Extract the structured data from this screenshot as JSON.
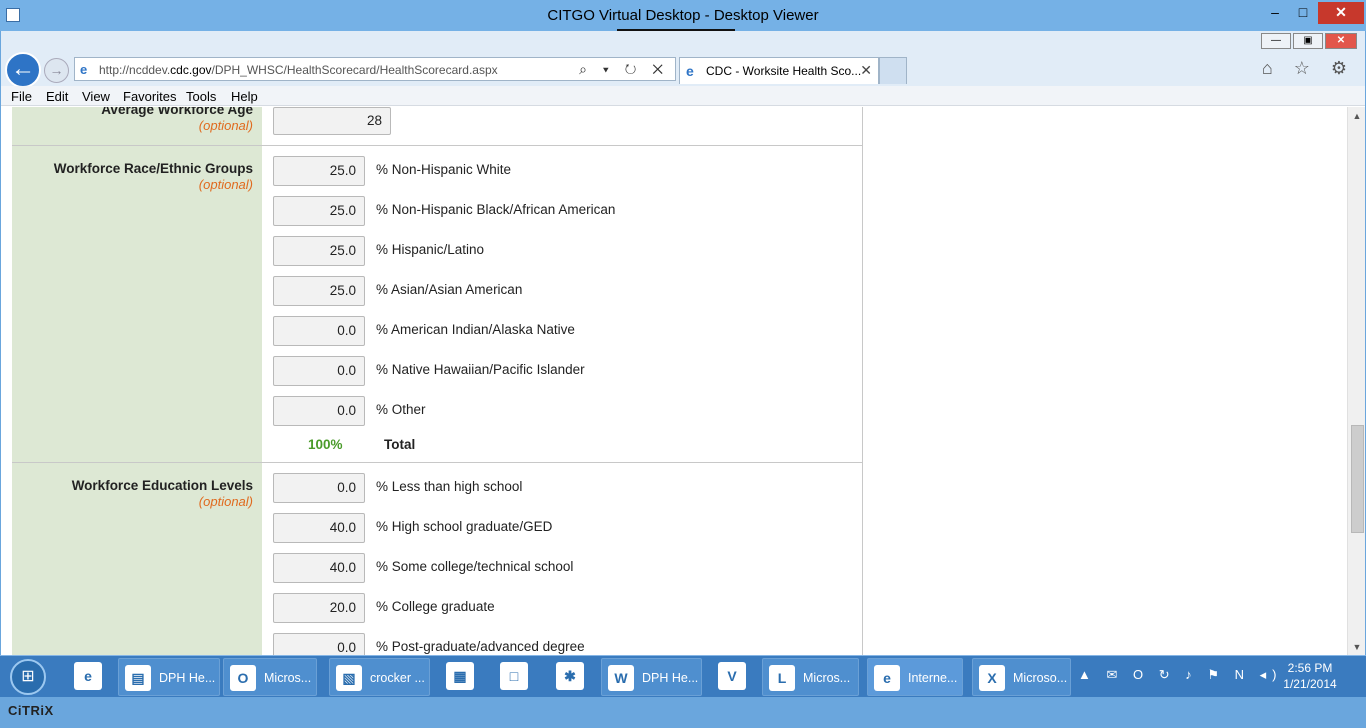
{
  "citrix": {
    "title": "CITGO Virtual Desktop - Desktop Viewer",
    "toolbar_handle": "░░░░ ⬇ ░░░░",
    "min": "–",
    "max": "□",
    "close": "✕",
    "brand": "CiTRiX"
  },
  "ie": {
    "back": "←",
    "forward": "→",
    "url_prefix": "http://ncddev.",
    "url_domain": "cdc.gov",
    "url_suffix": "/DPH_WHSC/HealthScorecard/HealthScorecard.aspx",
    "addr_controls": "⌕ ▾ ↻ ✕",
    "tab_label": "CDC - Worksite Health Sco...",
    "tab_close": "✕",
    "right_icons": "⌂ ☆ ⚙",
    "win_min": "—",
    "win_max": "▣",
    "win_close": "✕",
    "menu": [
      "File",
      "Edit",
      "View",
      "Favorites",
      "Tools",
      "Help"
    ]
  },
  "form": {
    "age": {
      "label": "Average Workforce Age",
      "optional": "(optional)",
      "value": "28"
    },
    "race": {
      "label": "Workforce Race/Ethnic Groups",
      "optional": "(optional)",
      "fields": [
        {
          "value": "25.0",
          "label": "% Non-Hispanic White"
        },
        {
          "value": "25.0",
          "label": "% Non-Hispanic Black/African American"
        },
        {
          "value": "25.0",
          "label": "% Hispanic/Latino"
        },
        {
          "value": "25.0",
          "label": "% Asian/Asian American"
        },
        {
          "value": "0.0",
          "label": "% American Indian/Alaska Native"
        },
        {
          "value": "0.0",
          "label": "% Native Hawaiian/Pacific Islander"
        },
        {
          "value": "0.0",
          "label": "% Other"
        }
      ],
      "total_value": "100%",
      "total_label": "Total"
    },
    "education": {
      "label": "Workforce Education Levels",
      "optional": "(optional)",
      "fields": [
        {
          "value": "0.0",
          "label": "% Less than high school"
        },
        {
          "value": "40.0",
          "label": "% High school graduate/GED"
        },
        {
          "value": "40.0",
          "label": "% Some college/technical school"
        },
        {
          "value": "20.0",
          "label": "% College graduate"
        },
        {
          "value": "0.0",
          "label": "% Post-graduate/advanced degree"
        }
      ]
    }
  },
  "taskbar": {
    "start": "⊞",
    "items": [
      {
        "icon": "e",
        "label": ""
      },
      {
        "icon": "▤",
        "label": "DPH He..."
      },
      {
        "icon": "O",
        "label": "Micros..."
      },
      {
        "icon": "▧",
        "label": "crocker ..."
      },
      {
        "icon": "▦",
        "label": ""
      },
      {
        "icon": "□",
        "label": ""
      },
      {
        "icon": "✱",
        "label": ""
      },
      {
        "icon": "W",
        "label": "DPH He..."
      },
      {
        "icon": "V",
        "label": ""
      },
      {
        "icon": "L",
        "label": "Micros..."
      },
      {
        "icon": "e",
        "label": "Interne..."
      },
      {
        "icon": "X",
        "label": "Microso..."
      }
    ],
    "tray": "▲ ✉ O ↻ ♪ ⚑ N ◂)",
    "time": "2:56 PM",
    "date": "1/21/2014"
  }
}
